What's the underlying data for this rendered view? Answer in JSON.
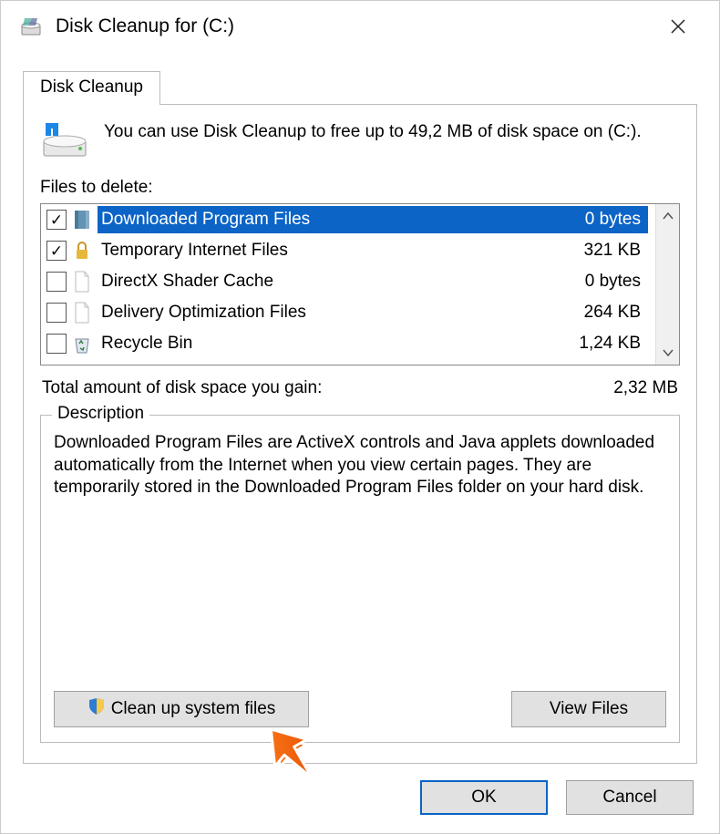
{
  "title": "Disk Cleanup for  (C:)",
  "tab": "Disk Cleanup",
  "intro": "You can use Disk Cleanup to free up to 49,2 MB of disk space on  (C:).",
  "files_label": "Files to delete:",
  "items": [
    {
      "label": "Downloaded Program Files",
      "size": "0 bytes",
      "checked": true,
      "selected": true
    },
    {
      "label": "Temporary Internet Files",
      "size": "321 KB",
      "checked": true,
      "selected": false
    },
    {
      "label": "DirectX Shader Cache",
      "size": "0 bytes",
      "checked": false,
      "selected": false
    },
    {
      "label": "Delivery Optimization Files",
      "size": "264 KB",
      "checked": false,
      "selected": false
    },
    {
      "label": "Recycle Bin",
      "size": "1,24 KB",
      "checked": false,
      "selected": false
    }
  ],
  "total_label": "Total amount of disk space you gain:",
  "total_value": "2,32 MB",
  "description_legend": "Description",
  "description_text": "Downloaded Program Files are ActiveX controls and Java applets downloaded automatically from the Internet when you view certain pages. They are temporarily stored in the Downloaded Program Files folder on your hard disk.",
  "clean_system_label": "Clean up system files",
  "view_files_label": "View Files",
  "ok_label": "OK",
  "cancel_label": "Cancel"
}
